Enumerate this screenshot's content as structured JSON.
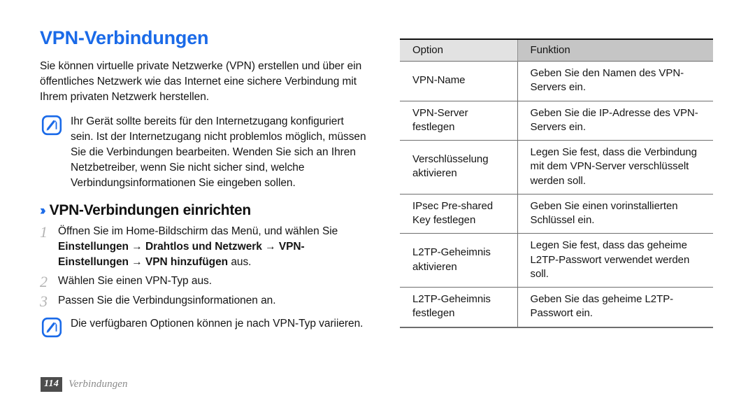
{
  "document": {
    "title": "VPN-Verbindungen",
    "title_color": "#1a6ae8",
    "intro": "Sie können virtuelle private Netzwerke (VPN) erstellen und über ein öffentliches Netzwerk wie das Internet eine sichere Verbindung mit Ihrem privaten Netzwerk herstellen."
  },
  "notes": {
    "first": "Ihr Gerät sollte bereits für den Internetzugang konfiguriert sein. Ist der Internetzugang nicht problemlos möglich, müssen Sie die Verbindungen bearbeiten. Wenden Sie sich an Ihren Netzbetreiber, wenn Sie nicht sicher sind, welche Verbindungsinformationen Sie eingeben sollen.",
    "second": "Die verfügbaren Optionen können je nach VPN-Typ variieren.",
    "icon": "note-pen-icon",
    "icon_color": "#1a6ae8"
  },
  "section": {
    "chevron": "››",
    "heading": "VPN-Verbindungen einrichten",
    "steps": [
      {
        "number": "1",
        "parts": [
          {
            "text": "Öffnen Sie im Home-Bildschirm das Menü, und wählen Sie ",
            "bold": false
          },
          {
            "text": "Einstellungen",
            "bold": true
          },
          {
            "text": " → ",
            "bold": true
          },
          {
            "text": "Drahtlos und Netzwerk",
            "bold": true
          },
          {
            "text": " → ",
            "bold": true
          },
          {
            "text": "VPN-Einstellungen",
            "bold": true
          },
          {
            "text": " → ",
            "bold": true
          },
          {
            "text": "VPN hinzufügen",
            "bold": true
          },
          {
            "text": " aus.",
            "bold": false
          }
        ]
      },
      {
        "number": "2",
        "parts": [
          {
            "text": "Wählen Sie einen VPN-Typ aus.",
            "bold": false
          }
        ]
      },
      {
        "number": "3",
        "parts": [
          {
            "text": "Passen Sie die Verbindungsinformationen an.",
            "bold": false
          }
        ]
      }
    ]
  },
  "table": {
    "headers": [
      "Option",
      "Funktion"
    ],
    "header_bg_left": "#e2e2e2",
    "header_bg_right": "#c5c5c5",
    "rows": [
      {
        "option": "VPN-Name",
        "funktion": "Geben Sie den Namen des VPN-Servers ein."
      },
      {
        "option": "VPN-Server festlegen",
        "funktion": "Geben Sie die IP-Adresse des VPN-Servers ein."
      },
      {
        "option": "Verschlüsselung aktivieren",
        "funktion": "Legen Sie fest, dass die Verbindung mit dem VPN-Server verschlüsselt werden soll."
      },
      {
        "option": "IPsec Pre-shared Key festlegen",
        "funktion": "Geben Sie einen vorinstallierten Schlüssel ein."
      },
      {
        "option": "L2TP-Geheimnis aktivieren",
        "funktion": "Legen Sie fest, dass das geheime L2TP-Passwort verwendet werden soll."
      },
      {
        "option": "L2TP-Geheimnis festlegen",
        "funktion": "Geben Sie das geheime L2TP-Passwort ein."
      }
    ]
  },
  "footer": {
    "page_number": "114",
    "chapter": "Verbindungen",
    "badge_bg": "#4d4d4d"
  }
}
